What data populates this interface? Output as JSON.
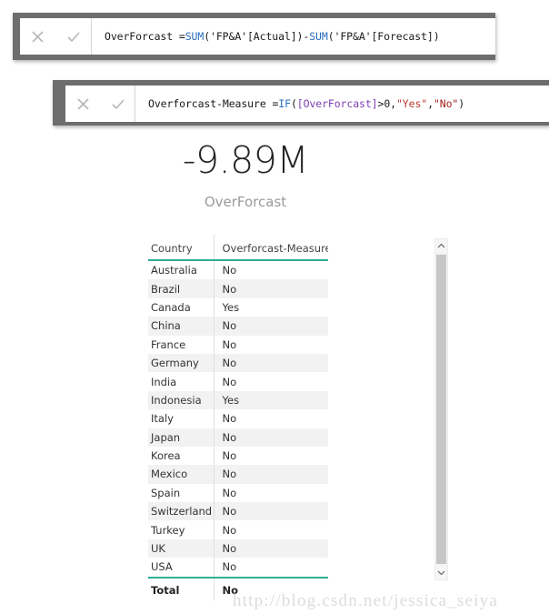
{
  "formula_bars": [
    {
      "cancel_icon": "close-icon",
      "accept_icon": "check-icon",
      "tokens": [
        {
          "t": "OverForcast = ",
          "c": "plain"
        },
        {
          "t": "SUM",
          "c": "fn"
        },
        {
          "t": "('FP&A'[Actual])-",
          "c": "plain"
        },
        {
          "t": "SUM",
          "c": "fn"
        },
        {
          "t": "('FP&A'[Forecast])",
          "c": "plain"
        }
      ],
      "text": "OverForcast = SUM('FP&A'[Actual])-SUM('FP&A'[Forecast])"
    },
    {
      "cancel_icon": "close-icon",
      "accept_icon": "check-icon",
      "tokens": [
        {
          "t": "Overforcast-Measure = ",
          "c": "plain"
        },
        {
          "t": "IF",
          "c": "fn"
        },
        {
          "t": "(",
          "c": "plain"
        },
        {
          "t": "[OverForcast]",
          "c": "ref"
        },
        {
          "t": ">0,",
          "c": "plain"
        },
        {
          "t": "\"Yes\"",
          "c": "str"
        },
        {
          "t": ",",
          "c": "plain"
        },
        {
          "t": "\"No\"",
          "c": "str2"
        },
        {
          "t": ")",
          "c": "plain"
        }
      ],
      "text": "Overforcast-Measure = IF([OverForcast]>0,\"Yes\",\"No\")"
    }
  ],
  "card": {
    "value": "-9.89M",
    "label": "OverForcast"
  },
  "table": {
    "columns": [
      "Country",
      "Overforcast-Measure"
    ],
    "rows": [
      [
        "Australia",
        "No"
      ],
      [
        "Brazil",
        "No"
      ],
      [
        "Canada",
        "Yes"
      ],
      [
        "China",
        "No"
      ],
      [
        "France",
        "No"
      ],
      [
        "Germany",
        "No"
      ],
      [
        "India",
        "No"
      ],
      [
        "Indonesia",
        "Yes"
      ],
      [
        "Italy",
        "No"
      ],
      [
        "Japan",
        "No"
      ],
      [
        "Korea",
        "No"
      ],
      [
        "Mexico",
        "No"
      ],
      [
        "Spain",
        "No"
      ],
      [
        "Switzerland",
        "No"
      ],
      [
        "Turkey",
        "No"
      ],
      [
        "UK",
        "No"
      ],
      [
        "USA",
        "No"
      ]
    ],
    "total_row": [
      "Total",
      "No"
    ],
    "accent_color": "#2eae95",
    "stripe_color": "#f2f2f2"
  },
  "scrollbar": {
    "up_icon": "chevron-up-icon",
    "down_icon": "chevron-down-icon"
  },
  "watermark": {
    "text": "http://blog.csdn.net/jessica_seiya"
  }
}
